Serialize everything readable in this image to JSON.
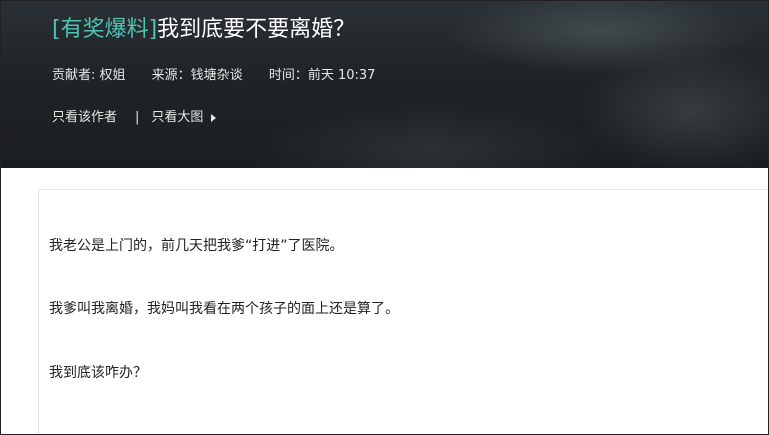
{
  "header": {
    "title_tag": "[有奖爆料]",
    "title_text": "我到底要不要离婚？",
    "meta": {
      "contributor": "贡献者: 权姐",
      "source": "来源：钱塘杂谈",
      "time": "时间：前天 10:37"
    },
    "actions": {
      "author_only": "只看该作者",
      "separator": "|",
      "large_images": "只看大图"
    }
  },
  "content": {
    "paragraphs": [
      "我老公是上门的，前几天把我爹“打进”了医院。",
      "我爹叫我离婚，我妈叫我看在两个孩子的面上还是算了。",
      "我到底该咋办？"
    ]
  }
}
